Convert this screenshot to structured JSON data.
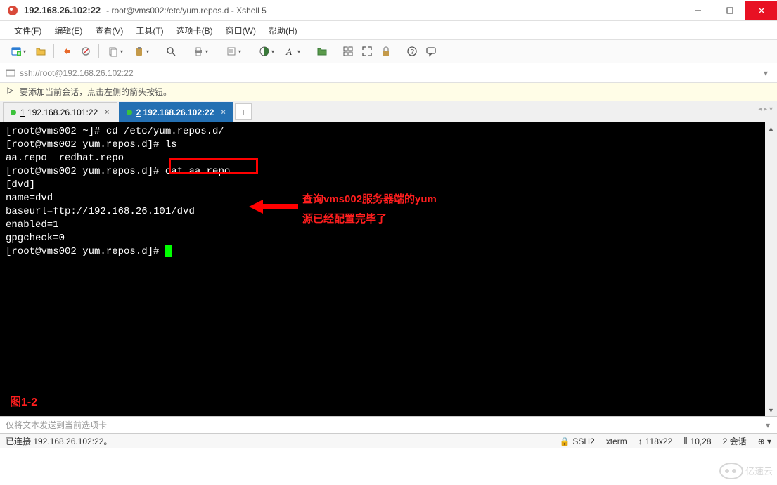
{
  "titlebar": {
    "ip_title": "192.168.26.102:22",
    "path_title": "root@vms002:/etc/yum.repos.d - Xshell 5"
  },
  "menubar": [
    "文件(F)",
    "编辑(E)",
    "查看(V)",
    "工具(T)",
    "选项卡(B)",
    "窗口(W)",
    "帮助(H)"
  ],
  "addressbar": {
    "url": "ssh://root@192.168.26.102:22"
  },
  "hintbar": {
    "text": "要添加当前会话，点击左侧的箭头按钮。"
  },
  "tabs": [
    {
      "num": "1",
      "label": "192.168.26.101:22",
      "active": false
    },
    {
      "num": "2",
      "label": "192.168.26.102:22",
      "active": true
    }
  ],
  "terminal": {
    "lines": [
      "[root@vms002 ~]# cd /etc/yum.repos.d/",
      "[root@vms002 yum.repos.d]# ls",
      "aa.repo  redhat.repo",
      "[root@vms002 yum.repos.d]# cat aa.repo",
      "[dvd]",
      "name=dvd",
      "baseurl=ftp://192.168.26.101/dvd",
      "enabled=1",
      "gpgcheck=0",
      "[root@vms002 yum.repos.d]# "
    ],
    "annotation_line1": "查询vms002服务器端的yum",
    "annotation_line2": "源已经配置完毕了",
    "highlighted_cmd": "cat aa.repo",
    "figure_label": "图1-2"
  },
  "send_hint": "仅将文本发送到当前选项卡",
  "statusbar": {
    "connected": "已连接 192.168.26.102:22。",
    "ssh": "SSH2",
    "term": "xterm",
    "size": "118x22",
    "pos": "10,28",
    "sessions": "2 会话"
  },
  "watermark_text": "亿速云"
}
